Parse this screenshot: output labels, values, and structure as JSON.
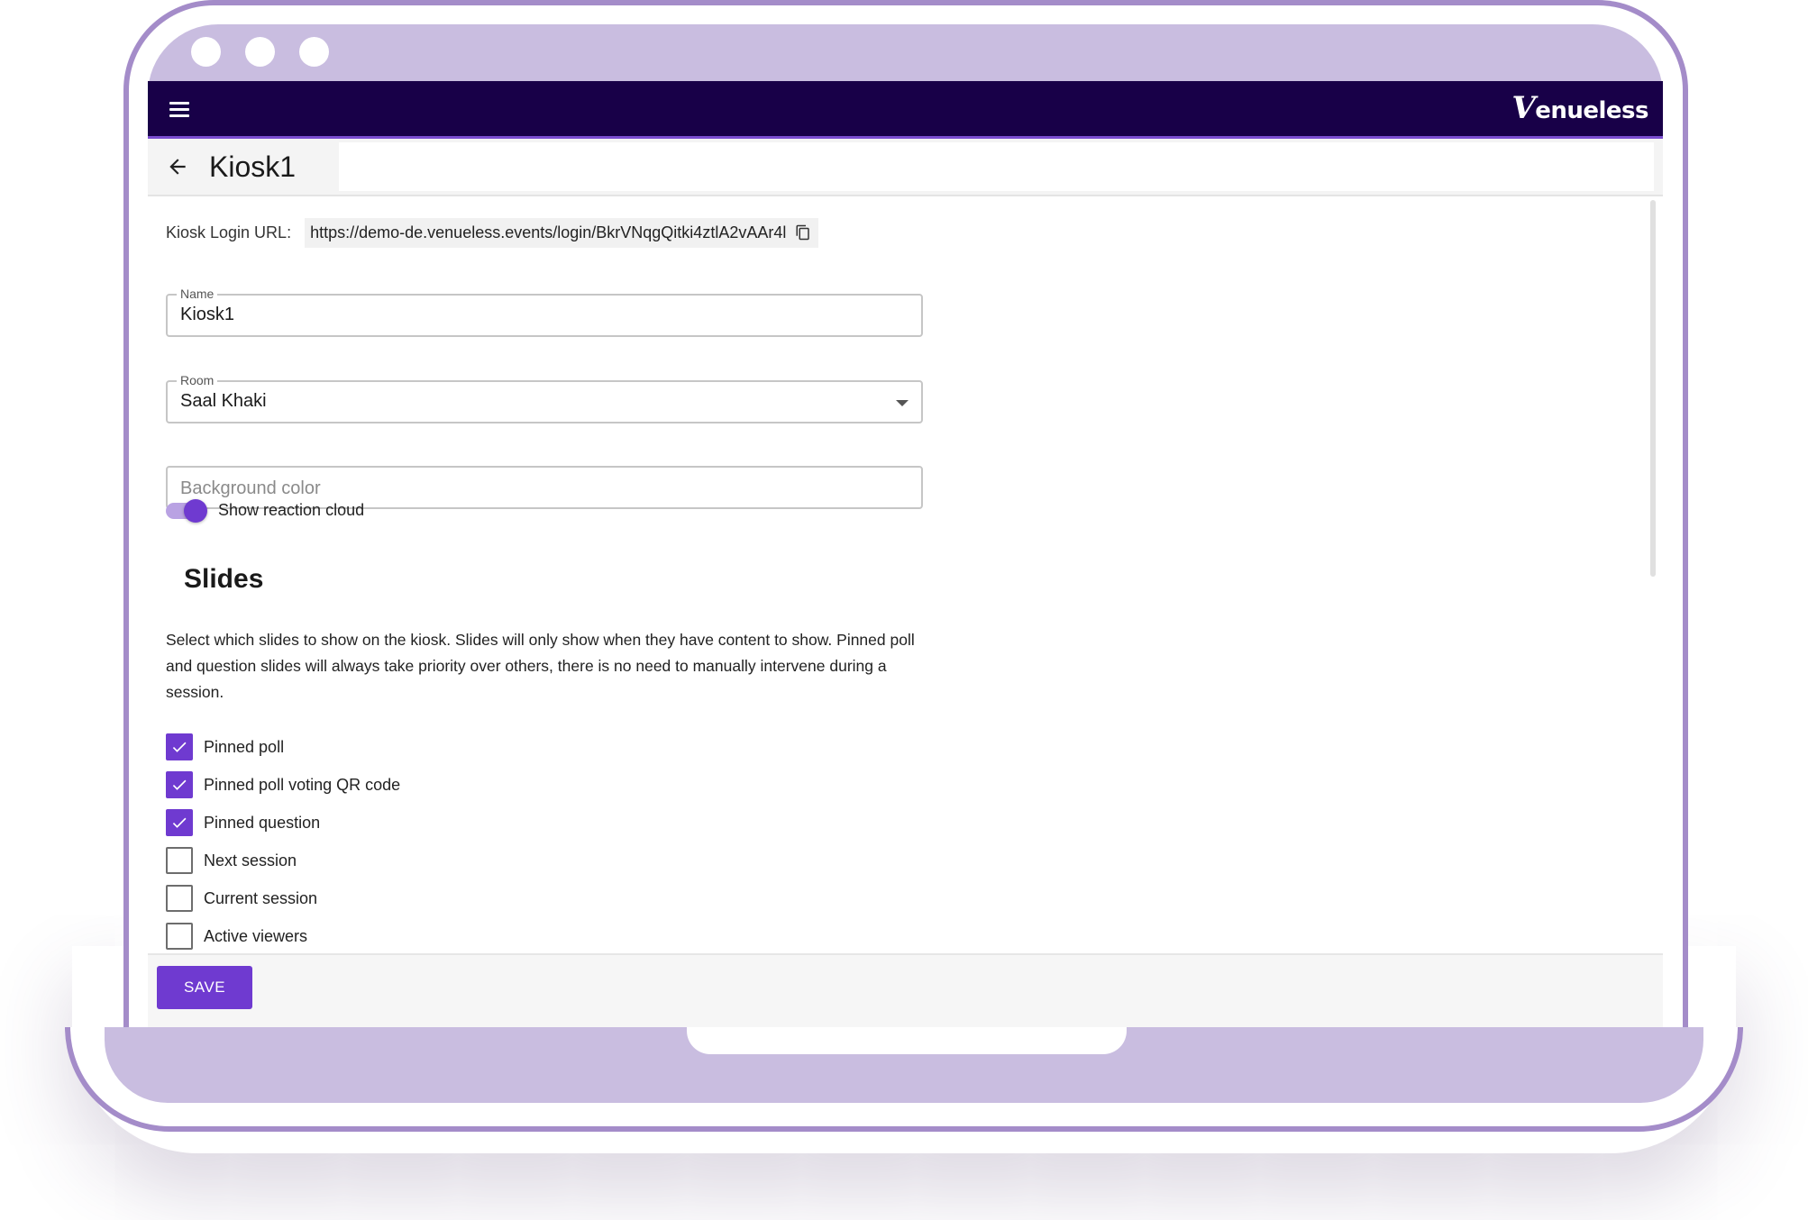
{
  "app": {
    "brand_initial": "V",
    "brand_rest": "enueless",
    "accent_color": "#6f3ad0",
    "topbar_color": "#180048",
    "frame_color": "#c9bde0"
  },
  "icons": {
    "menu": "hamburger-icon",
    "back": "arrow-left-icon",
    "copy": "copy-icon",
    "caret": "chevron-down-icon"
  },
  "header": {
    "title": "Kiosk1"
  },
  "kiosk": {
    "url_label": "Kiosk Login URL:",
    "url_value": "https://demo-de.venueless.events/login/BkrVNqgQitki4ztlA2vAAr4l"
  },
  "form": {
    "name": {
      "label": "Name",
      "value": "Kiosk1"
    },
    "room": {
      "label": "Room",
      "value": "Saal Khaki"
    },
    "background": {
      "placeholder": "Background color",
      "value": ""
    },
    "reaction_toggle": {
      "label": "Show reaction cloud",
      "checked": true
    }
  },
  "slides": {
    "title": "Slides",
    "description": "Select which slides to show on the kiosk. Slides will only show when they have content to show. Pinned poll and question slides will always take priority over others, there is no need to manually intervene during a session.",
    "items": [
      {
        "label": "Pinned poll",
        "checked": true
      },
      {
        "label": "Pinned poll voting QR code",
        "checked": true
      },
      {
        "label": "Pinned question",
        "checked": true
      },
      {
        "label": "Next session",
        "checked": false
      },
      {
        "label": "Current session",
        "checked": false
      },
      {
        "label": "Active viewers",
        "checked": false
      }
    ]
  },
  "footer": {
    "save_label": "SAVE"
  }
}
